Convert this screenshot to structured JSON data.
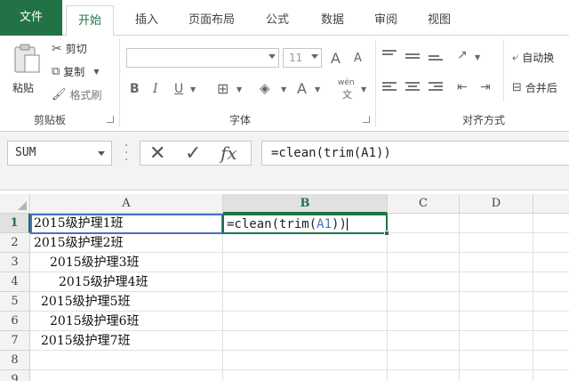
{
  "ribbon_tabs": [
    "文件",
    "开始",
    "插入",
    "页面布局",
    "公式",
    "数据",
    "审阅",
    "视图"
  ],
  "clipboard": {
    "paste_label": "粘贴",
    "cut_label": "剪切",
    "copy_label": "复制",
    "format_painter_label": "格式刷",
    "group_label": "剪贴板"
  },
  "font": {
    "font_name": "",
    "font_size": "11",
    "bold": "B",
    "italic": "I",
    "underline": "U",
    "grow": "A",
    "shrink": "A",
    "font_color": "A",
    "phonetic": "wén",
    "phonetic_sub": "文",
    "group_label": "字体"
  },
  "alignment": {
    "wrap_label": "自动换",
    "merge_label": "合并后",
    "group_label": "对齐方式"
  },
  "formula_bar": {
    "name_box": "SUM",
    "cancel": "✕",
    "enter": "✓",
    "fx": "fx",
    "formula": "=clean(trim(A1))"
  },
  "columns": [
    "A",
    "B",
    "C",
    "D"
  ],
  "rows": [
    "1",
    "2",
    "3",
    "4",
    "5",
    "6",
    "7",
    "8",
    "9"
  ],
  "cells": {
    "A1": "2015级护理1班",
    "A2": "2015级护理2班",
    "A3": "2015级护理3班",
    "A4": "2015级护理4班",
    "A5": "2015级护理5班",
    "A6": "2015级护理6班",
    "A7": "2015级护理7班"
  },
  "edit": {
    "prefix": "=clean(trim(",
    "ref": "A1",
    "suffix": "))"
  },
  "colors": {
    "excel_green": "#217346",
    "ref_blue": "#4472c4"
  }
}
